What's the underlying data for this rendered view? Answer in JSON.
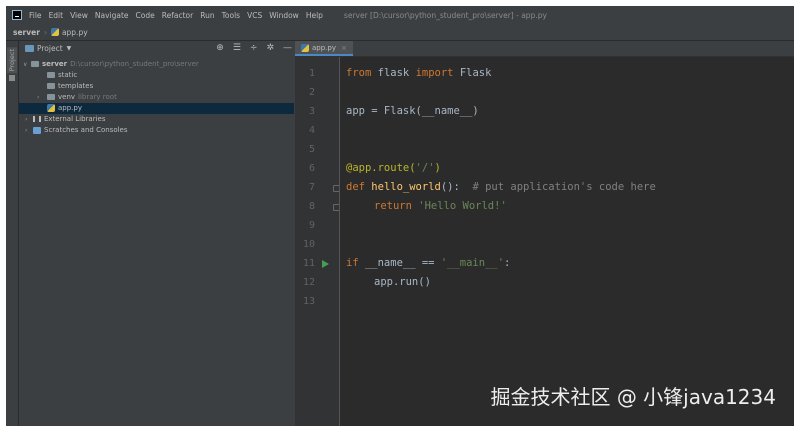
{
  "window": {
    "title": "server [D:\\cursor\\python_student_pro\\server] - app.py",
    "menu": [
      "File",
      "Edit",
      "View",
      "Navigate",
      "Code",
      "Refactor",
      "Run",
      "Tools",
      "VCS",
      "Window",
      "Help"
    ]
  },
  "breadcrumb": {
    "project": "server",
    "file": "app.py"
  },
  "tool_strip": {
    "label": "Project"
  },
  "project_panel": {
    "header": "Project",
    "tools": [
      "⊕",
      "☰",
      "÷",
      "✲",
      "—"
    ],
    "tree": [
      {
        "name": "server",
        "hint": "D:\\cursor\\python_student_pro\\server"
      },
      {
        "name": "static"
      },
      {
        "name": "templates"
      },
      {
        "name": "venv",
        "hint": "library root"
      },
      {
        "name": "app.py"
      },
      {
        "name": "External Libraries"
      },
      {
        "name": "Scratches and Consoles"
      }
    ]
  },
  "editor": {
    "tab": "app.py",
    "line_numbers": [
      "1",
      "2",
      "3",
      "4",
      "5",
      "6",
      "7",
      "8",
      "9",
      "10",
      "11",
      "12",
      "13"
    ],
    "code": {
      "l1_kw1": "from",
      "l1_mod": " flask ",
      "l1_kw2": "import",
      "l1_name": " Flask",
      "l3": "app = Flask(__name__)",
      "l6_deco": "@app.route(",
      "l6_str": "'/'",
      "l6_close": ")",
      "l7_kw": "def ",
      "l7_fn": "hello_world",
      "l7_rest": "():  ",
      "l7_cmt": "# put application's code here",
      "l8_kw": "return ",
      "l8_str": "'Hello World!'",
      "l11_kw": "if ",
      "l11_mid": "__name__ == ",
      "l11_str": "'__main__'",
      "l11_end": ":",
      "l12": "app.run()"
    }
  },
  "watermark": "掘金技术社区 @ 小锋java1234"
}
